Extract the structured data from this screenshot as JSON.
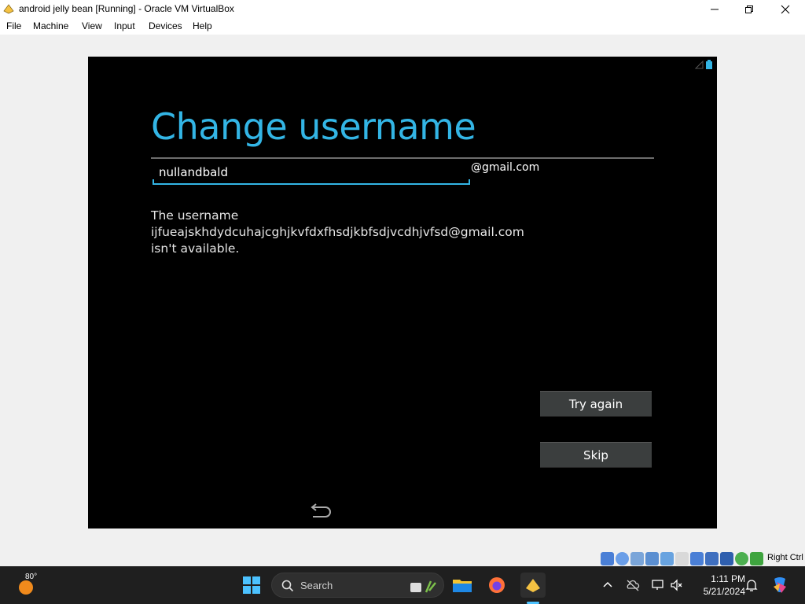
{
  "window": {
    "title": "android jelly bean [Running] - Oracle VM VirtualBox",
    "minimize_icon": "minimize-icon",
    "maximize_icon": "restore-icon",
    "close_icon": "close-icon"
  },
  "menu": {
    "items": [
      {
        "label": "File"
      },
      {
        "label": "Machine"
      },
      {
        "label": "View"
      },
      {
        "label": "Input"
      },
      {
        "label": "Devices"
      },
      {
        "label": "Help"
      }
    ]
  },
  "android": {
    "heading": "Change username",
    "username_value": "nullandbald",
    "domain_suffix": "@gmail.com",
    "error_lines": [
      "The username",
      "ijfueajskhdydcuhajcghjkvfdxfhsdjkbfsdjvcdhjvfsd@gmail.com",
      "isn't available."
    ],
    "try_again_label": "Try again",
    "skip_label": "Skip",
    "accent_color": "#33b5e5",
    "button_color": "#3b3e3e"
  },
  "vbox_status": {
    "host_key": "Right Ctrl"
  },
  "taskbar": {
    "weather_temp": "80°",
    "search_placeholder": "Search",
    "clock_time": "1:11 PM",
    "clock_date": "5/21/2024",
    "background": "#1f1f1f"
  }
}
